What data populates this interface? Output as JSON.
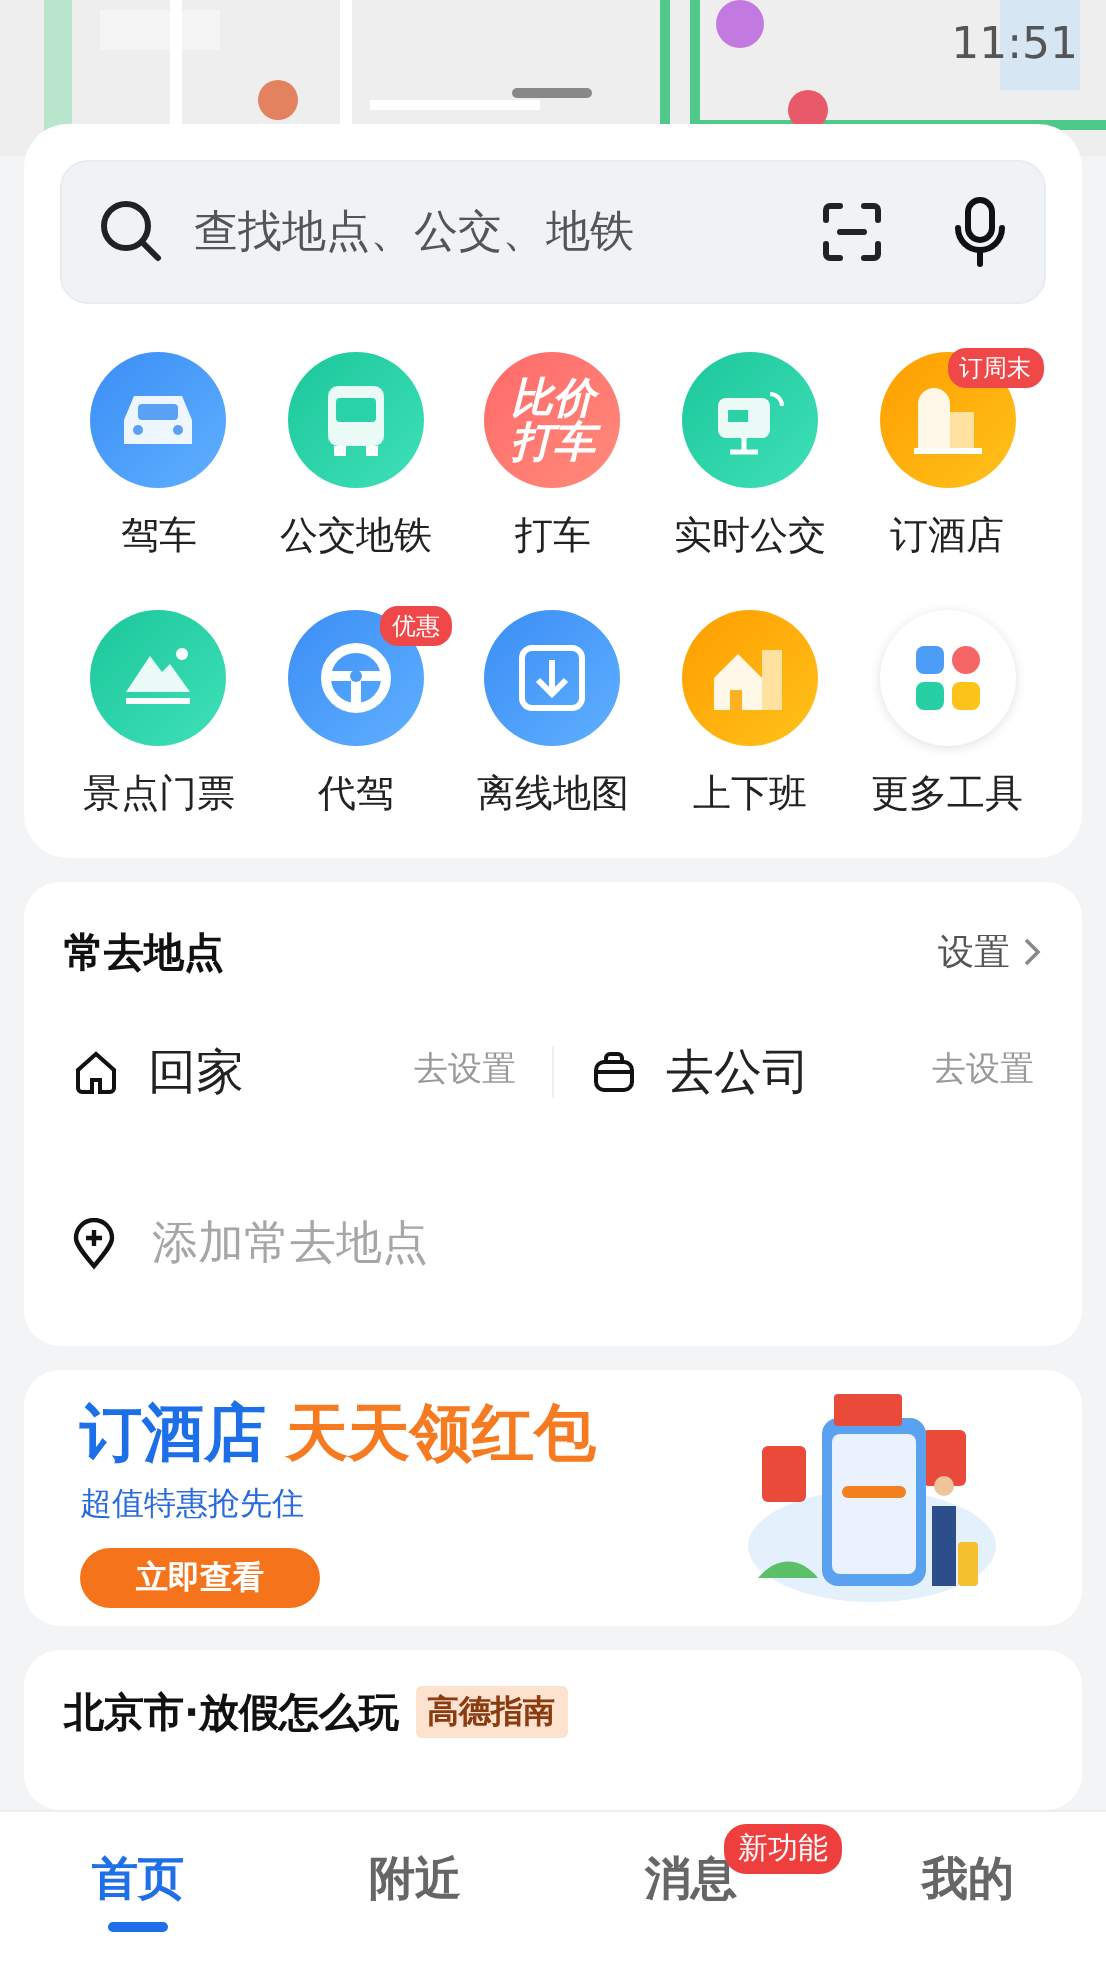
{
  "status_bar": {
    "time": "11:51"
  },
  "search": {
    "placeholder": "查找地点、公交、地铁"
  },
  "tools": [
    {
      "kind": "car",
      "label": "驾车"
    },
    {
      "kind": "bus",
      "label": "公交地铁"
    },
    {
      "kind": "taxi",
      "label": "打车",
      "icon_text": "比价打车"
    },
    {
      "kind": "realtime",
      "label": "实时公交"
    },
    {
      "kind": "hotel",
      "label": "订酒店",
      "badge": "订周末"
    },
    {
      "kind": "scenic",
      "label": "景点门票"
    },
    {
      "kind": "driver",
      "label": "代驾",
      "badge": "优惠"
    },
    {
      "kind": "offline",
      "label": "离线地图"
    },
    {
      "kind": "commute",
      "label": "上下班"
    },
    {
      "kind": "more",
      "label": "更多工具"
    }
  ],
  "frequent": {
    "title": "常去地点",
    "settings": "设置",
    "places": [
      {
        "kind": "home",
        "label": "回家",
        "action": "去设置"
      },
      {
        "kind": "work",
        "label": "去公司",
        "action": "去设置"
      }
    ],
    "add": "添加常去地点"
  },
  "banner": {
    "title_blue": "订酒店",
    "title_orange": "天天领红包",
    "subtitle": "超值特惠抢先住",
    "button": "立即查看"
  },
  "guide": {
    "title": "北京市·放假怎么玩",
    "tag": "高德指南"
  },
  "tabs": [
    {
      "label": "首页",
      "selected": true
    },
    {
      "label": "附近",
      "selected": false
    },
    {
      "label": "消息",
      "selected": false,
      "badge": "新功能"
    },
    {
      "label": "我的",
      "selected": false
    }
  ]
}
